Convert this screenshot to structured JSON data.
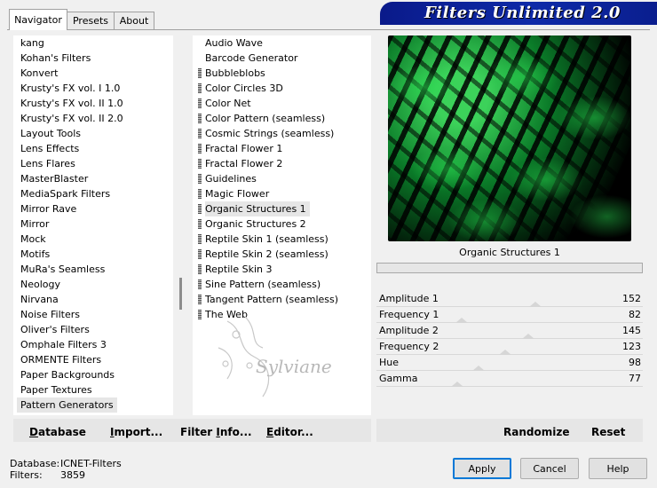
{
  "tabs": [
    "Navigator",
    "Presets",
    "About"
  ],
  "banner_title": "Filters Unlimited 2.0",
  "categories": [
    "kang",
    "Kohan's Filters",
    "Konvert",
    "Krusty's FX vol. I 1.0",
    "Krusty's FX vol. II 1.0",
    "Krusty's FX vol. II 2.0",
    "Layout Tools",
    "Lens Effects",
    "Lens Flares",
    "MasterBlaster",
    "MediaSpark Filters",
    "Mirror Rave",
    "Mirror",
    "Mock",
    "Motifs",
    "MuRa's Seamless",
    "Neology",
    "Nirvana",
    "Noise Filters",
    "Oliver's Filters",
    "Omphale Filters 3",
    "ORMENTE Filters",
    "Paper Backgrounds",
    "Paper Textures",
    "Pattern Generators"
  ],
  "selected_category": "Pattern Generators",
  "filters": [
    {
      "name": "Audio Wave",
      "marker": false
    },
    {
      "name": "Barcode Generator",
      "marker": false
    },
    {
      "name": "Bubbleblobs",
      "marker": true
    },
    {
      "name": "Color Circles 3D",
      "marker": true
    },
    {
      "name": "Color Net",
      "marker": true
    },
    {
      "name": "Color Pattern (seamless)",
      "marker": true
    },
    {
      "name": "Cosmic Strings (seamless)",
      "marker": true
    },
    {
      "name": "Fractal Flower 1",
      "marker": true
    },
    {
      "name": "Fractal Flower 2",
      "marker": true
    },
    {
      "name": "Guidelines",
      "marker": true
    },
    {
      "name": "Magic Flower",
      "marker": true
    },
    {
      "name": "Organic Structures 1",
      "marker": true
    },
    {
      "name": "Organic Structures 2",
      "marker": true
    },
    {
      "name": "Reptile Skin 1 (seamless)",
      "marker": true
    },
    {
      "name": "Reptile Skin 2 (seamless)",
      "marker": true
    },
    {
      "name": "Reptile Skin 3",
      "marker": true
    },
    {
      "name": "Sine Pattern (seamless)",
      "marker": true
    },
    {
      "name": "Tangent Pattern (seamless)",
      "marker": true
    },
    {
      "name": "The Web",
      "marker": true
    }
  ],
  "selected_filter": "Organic Structures 1",
  "preview_title": "Organic Structures 1",
  "watermark_text": "Sylviane",
  "params": [
    {
      "label": "Amplitude 1",
      "value": 152
    },
    {
      "label": "Frequency 1",
      "value": 82
    },
    {
      "label": "Amplitude 2",
      "value": 145
    },
    {
      "label": "Frequency 2",
      "value": 123
    },
    {
      "label": "Hue",
      "value": 98
    },
    {
      "label": "Gamma",
      "value": 77
    }
  ],
  "param_max": 255,
  "toolbar": {
    "database": {
      "pre": "",
      "key": "D",
      "rest": "atabase"
    },
    "import": {
      "pre": "",
      "key": "I",
      "rest": "mport..."
    },
    "filter_info": {
      "pre": "Filter ",
      "key": "I",
      "rest": "nfo..."
    },
    "editor": {
      "pre": "",
      "key": "E",
      "rest": "ditor..."
    }
  },
  "randomize_label": "Randomize",
  "reset_label": "Reset",
  "buttons": {
    "apply": "Apply",
    "cancel": "Cancel",
    "help": "Help"
  },
  "info": {
    "database_label": "Database:",
    "database_value": "ICNET-Filters",
    "filters_label": "Filters:",
    "filters_value": "3859"
  }
}
